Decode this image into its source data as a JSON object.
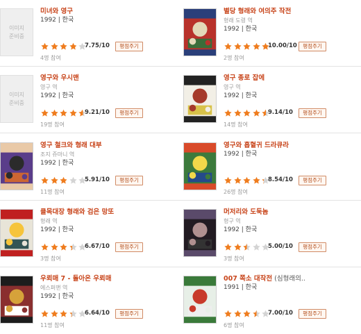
{
  "no_image_label": [
    "이미지",
    "준비중"
  ],
  "rate_button_label": "평점주기",
  "colors": {
    "title": "#c8441a",
    "star_on": "#ef7d1f",
    "star_off": "#d4d4d4"
  },
  "movies": [
    {
      "title": "미녀와 영구",
      "extra": "",
      "cast": "",
      "meta": "1992 | 한국",
      "rating": 7.75,
      "score": "7.75/10",
      "count": "4명 참여",
      "image": "none"
    },
    {
      "title": "별당 형래와 여의주 작전",
      "extra": "",
      "cast": "형래 도령 역",
      "meta": "1992 | 한국",
      "rating": 10.0,
      "score": "10.00/10",
      "count": "2명 참여",
      "image": "poster"
    },
    {
      "title": "영구와 우시맨",
      "extra": "",
      "cast": "영구 역",
      "meta": "1992 | 한국",
      "rating": 9.21,
      "score": "9.21/10",
      "count": "19명 참여",
      "image": "none"
    },
    {
      "title": "영구 종로 잡에",
      "extra": "",
      "cast": "영구 역",
      "meta": "1992 | 한국",
      "rating": 9.14,
      "score": "9.14/10",
      "count": "14명 참여",
      "image": "poster"
    },
    {
      "title": "영구 철크와 형래 대부",
      "extra": "",
      "cast": "조지 쥬마니 역",
      "meta": "1992 | 한국",
      "rating": 5.91,
      "score": "5.91/10",
      "count": "11명 참여",
      "image": "poster"
    },
    {
      "title": "영구와 흡혈귀 드라큐라",
      "extra": "",
      "cast": "",
      "meta": "1992 | 한국",
      "rating": 8.54,
      "score": "8.54/10",
      "count": "26명 참여",
      "image": "poster"
    },
    {
      "title": "클목대장 형래와 검은 망또",
      "extra": "",
      "cast": "형래 역",
      "meta": "1992 | 한국",
      "rating": 6.67,
      "score": "6.67/10",
      "count": "3명 참여",
      "image": "poster"
    },
    {
      "title": "머저리와 도둑놈",
      "extra": "",
      "cast": "형구 역",
      "meta": "1992 | 한국",
      "rating": 5.0,
      "score": "5.00/10",
      "count": "3명 참여",
      "image": "poster"
    },
    {
      "title": "우뢰매 7 - 돌아온 우뢰매",
      "extra": "",
      "cast": "에스퍼맨 역",
      "meta": "1992 | 한국",
      "rating": 6.64,
      "score": "6.64/10",
      "count": "11명 참여",
      "image": "poster"
    },
    {
      "title": "007 쪽소 대작전",
      "extra": "(심형래의..",
      "cast": "",
      "meta": "1991 | 한국",
      "rating": 7.0,
      "score": "7.00/10",
      "count": "6명 참여",
      "image": "poster"
    }
  ]
}
